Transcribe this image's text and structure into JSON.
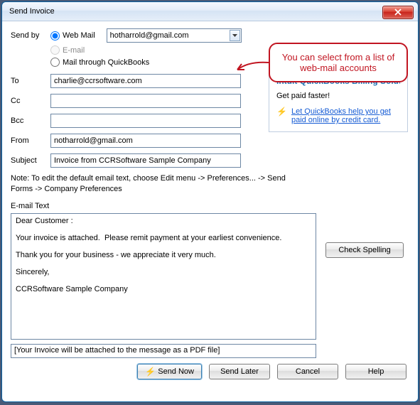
{
  "window": {
    "title": "Send Invoice"
  },
  "send_by": {
    "label": "Send by",
    "options": {
      "web_mail": "Web Mail",
      "email": "E-mail",
      "mail_qb": "Mail through QuickBooks"
    },
    "selected": "web_mail",
    "account_value": "hotharrold@gmail.com"
  },
  "fields": {
    "to_label": "To",
    "to_value": "charlie@ccrsoftware.com",
    "cc_label": "Cc",
    "cc_value": "",
    "bcc_label": "Bcc",
    "bcc_value": "",
    "from_label": "From",
    "from_value": "notharrold@gmail.com",
    "subject_label": "Subject",
    "subject_value": "Invoice from CCRSoftware Sample Company"
  },
  "note": "Note: To edit the default email text, choose Edit menu -> Preferences... -> Send Forms -> Company Preferences",
  "email_text_label": "E-mail Text",
  "email_text": "Dear Customer :\n\nYour invoice is attached.  Please remit payment at your earliest convenience.\n\nThank you for your business - we appreciate it very much.\n\nSincerely,\n\nCCRSoftware Sample Company",
  "attachment_note": "[Your Invoice will be attached to the message as a PDF file]",
  "buttons": {
    "check_spelling": "Check Spelling",
    "send_now": "Send Now",
    "send_later": "Send Later",
    "cancel": "Cancel",
    "help": "Help"
  },
  "sidepanel": {
    "header": "Intuit QuickBooks Billing Solution",
    "subheader": "Get paid faster!",
    "link": "Let QuickBooks help you get paid online by credit card."
  },
  "callout": "You can select from a list of web-mail accounts"
}
